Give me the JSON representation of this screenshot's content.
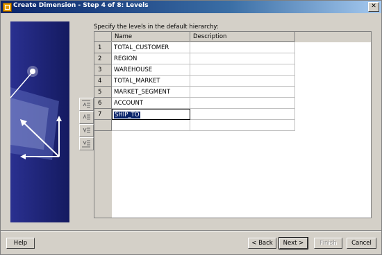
{
  "window": {
    "title": "Create Dimension - Step 4 of 8: Levels",
    "close_glyph": "✕"
  },
  "instruction": "Specify the levels in the default hierarchy:",
  "table": {
    "columns": [
      "Name",
      "Description"
    ],
    "rows": [
      {
        "num": "1",
        "name": "TOTAL_CUSTOMER",
        "description": ""
      },
      {
        "num": "2",
        "name": "REGION",
        "description": ""
      },
      {
        "num": "3",
        "name": "WAREHOUSE",
        "description": ""
      },
      {
        "num": "4",
        "name": "TOTAL_MARKET",
        "description": ""
      },
      {
        "num": "5",
        "name": "MARKET_SEGMENT",
        "description": ""
      },
      {
        "num": "6",
        "name": "ACCOUNT",
        "description": ""
      },
      {
        "num": "7",
        "name": "SHIP_TO",
        "description": ""
      }
    ]
  },
  "side_buttons": [
    {
      "icon": "move-top-icon"
    },
    {
      "icon": "move-up-icon"
    },
    {
      "icon": "move-down-icon"
    },
    {
      "icon": "move-bottom-icon"
    }
  ],
  "buttons": {
    "help": "Help",
    "back": "< Back",
    "next": "Next >",
    "finish": "Finish",
    "cancel": "Cancel"
  }
}
